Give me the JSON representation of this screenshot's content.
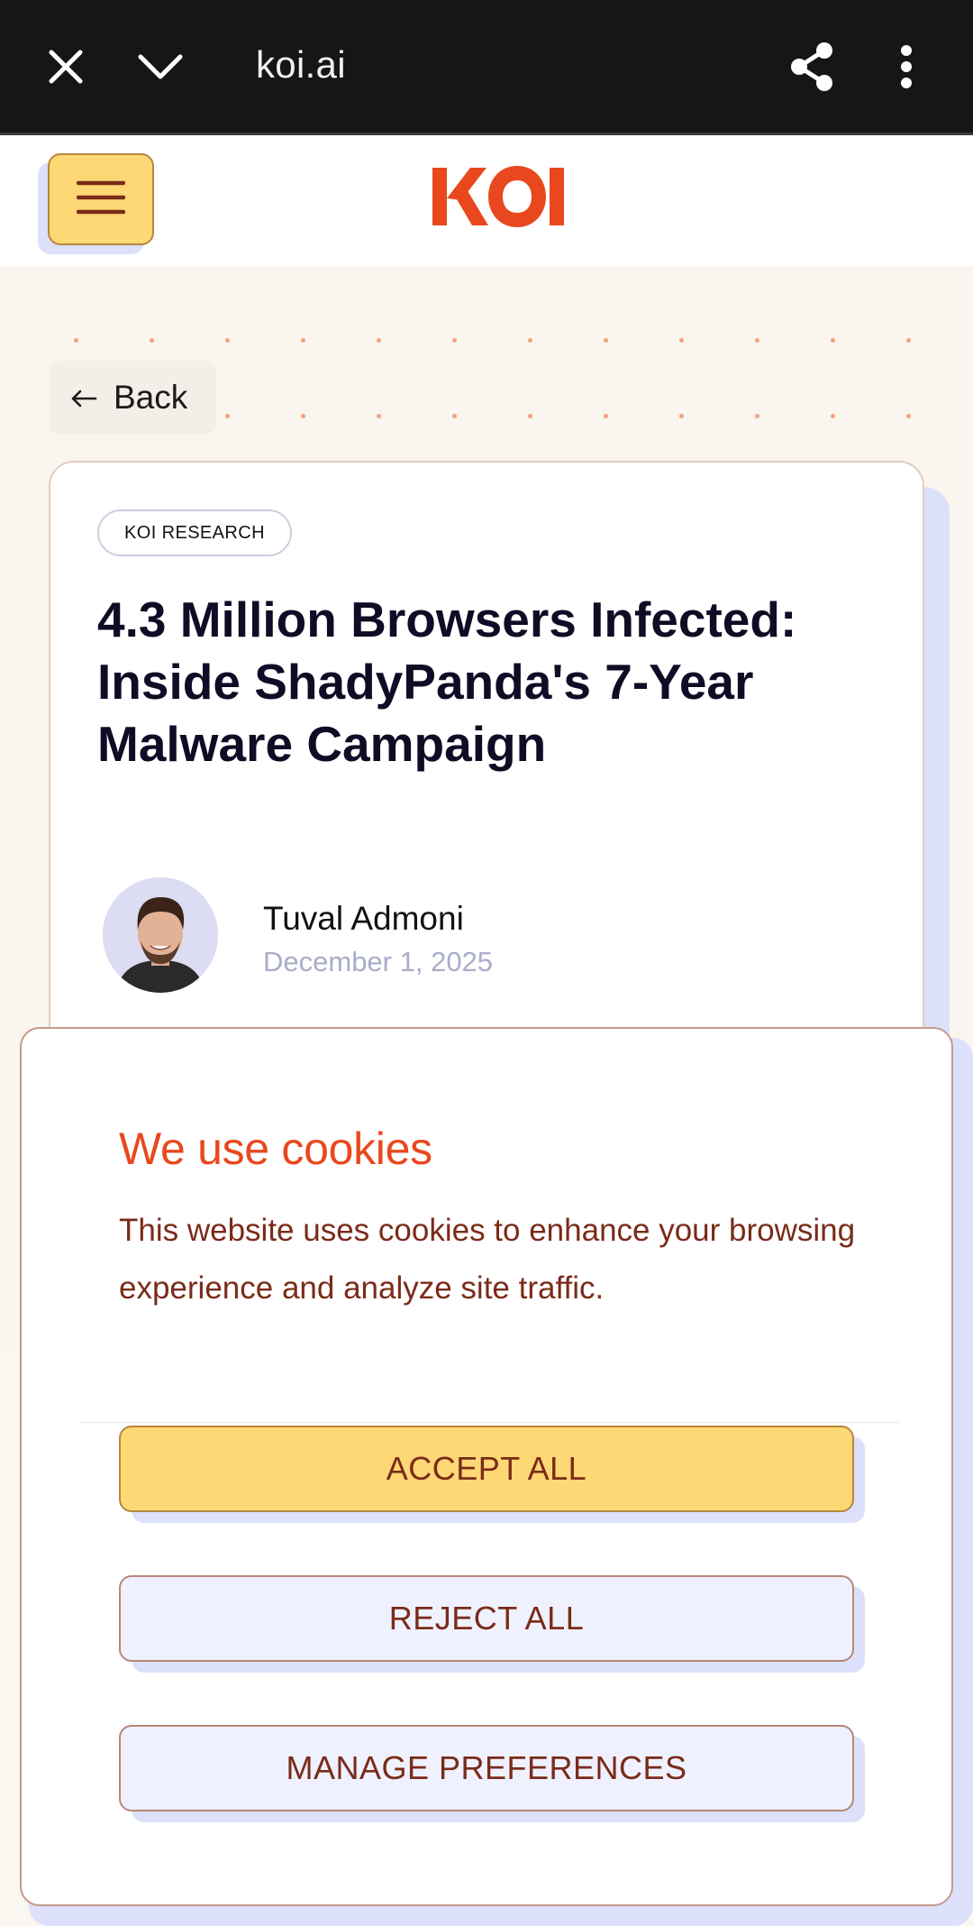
{
  "browser": {
    "url": "koi.ai",
    "icons": [
      "close-icon",
      "chevron-down-icon",
      "share-icon",
      "more-vert-icon"
    ]
  },
  "header": {
    "logo_text": "KOI",
    "menu_icon": "hamburger-icon"
  },
  "nav": {
    "back_label": "Back",
    "back_icon": "arrow-left-icon"
  },
  "article": {
    "tag": "KOI RESEARCH",
    "title": "4.3 Million Browsers Infected: Inside ShadyPanda's 7-Year Malware Campaign",
    "author": "Tuval Admoni",
    "date": "December 1, 2025"
  },
  "cookie": {
    "title": "We use cookies",
    "text": "This website uses cookies to enhance your browsing experience and analyze site traffic.",
    "accept_label": "ACCEPT ALL",
    "reject_label": "REJECT ALL",
    "manage_label": "MANAGE PREFERENCES"
  },
  "colors": {
    "brand_orange": "#e9481e",
    "accent_yellow": "#fdd874",
    "text_brown": "#7a2b19",
    "shadow_lavender": "#dde0fb"
  }
}
